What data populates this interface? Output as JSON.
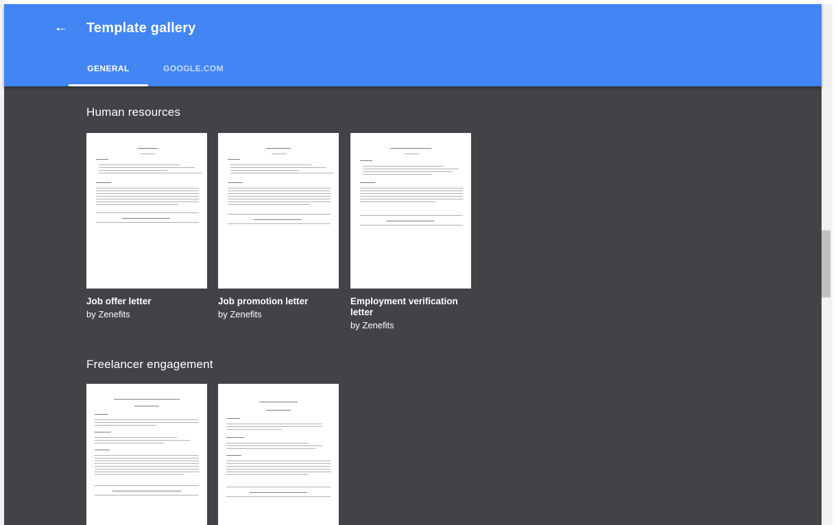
{
  "header": {
    "back_icon": "arrow-left-icon",
    "title": "Template gallery",
    "color": "#4285f4"
  },
  "tabs": [
    {
      "label": "GENERAL",
      "active": true
    },
    {
      "label": "GOOGLE.COM",
      "active": false
    }
  ],
  "sections": [
    {
      "title": "Human resources",
      "cards": [
        {
          "title": "Job offer letter",
          "author": "by Zenefits"
        },
        {
          "title": "Job promotion letter",
          "author": "by Zenefits"
        },
        {
          "title": "Employment verification letter",
          "author": "by Zenefits"
        }
      ]
    },
    {
      "title": "Freelancer engagement",
      "cards": [
        {
          "title": "",
          "author": ""
        },
        {
          "title": "",
          "author": ""
        }
      ]
    }
  ],
  "colors": {
    "content_bg": "#424347",
    "header_bg": "#4285f4"
  }
}
